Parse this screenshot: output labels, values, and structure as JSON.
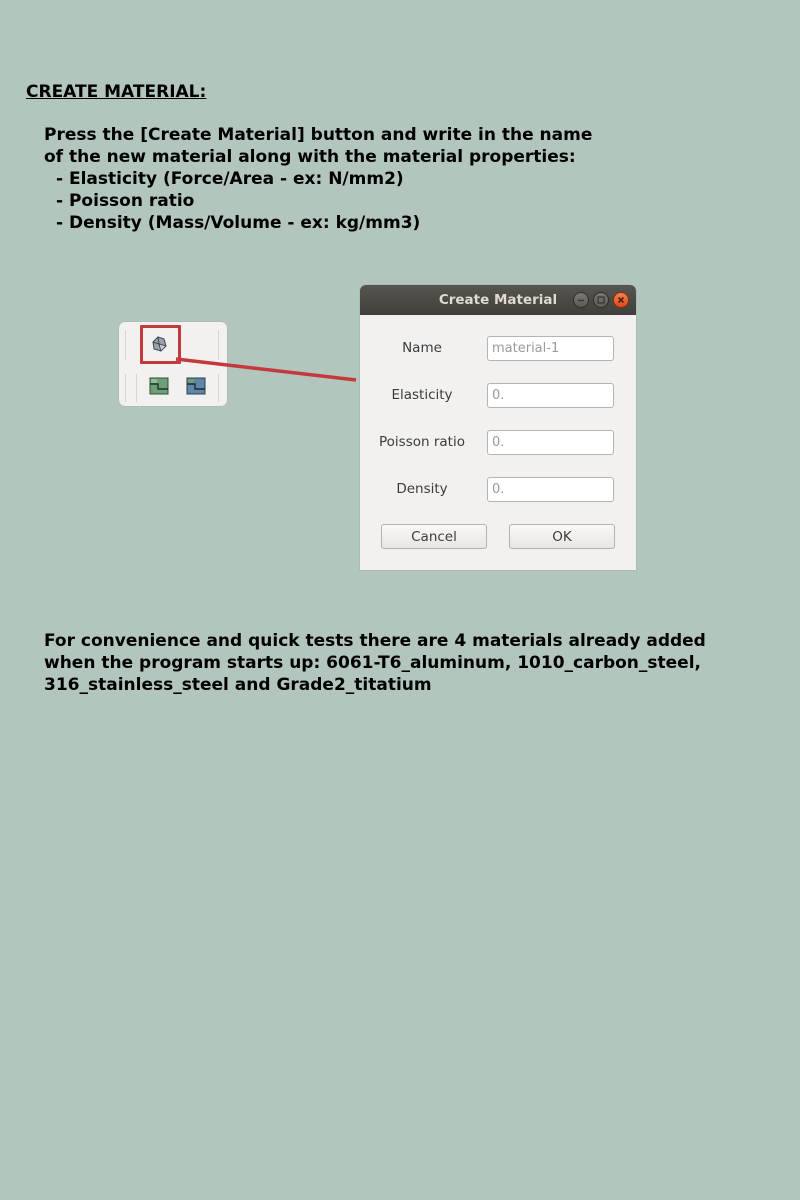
{
  "instructions": {
    "heading": "CREATE MATERIAL:",
    "intro_lines": [
      "Press the [Create Material] button and write in the name",
      "of the new material along with the material properties:",
      "- Elasticity (Force/Area - ex: N/mm2)",
      "- Poisson ratio",
      "- Density (Mass/Volume - ex: kg/mm3)"
    ],
    "footnote_lines": [
      "For convenience and quick tests there are 4 materials already added",
      "when the program starts up: 6061-T6_aluminum, 1010_carbon_steel,",
      "316_stainless_steel and Grade2_titatium"
    ]
  },
  "toolbar": {
    "icons": [
      "create-material-icon",
      "section-icon-green",
      "section-icon-blue"
    ],
    "highlight_color": "#c4393c"
  },
  "dialog": {
    "title": "Create Material",
    "window_buttons": [
      "minimize",
      "maximize",
      "close"
    ],
    "fields": [
      {
        "label": "Name",
        "placeholder": "material-1"
      },
      {
        "label": "Elasticity",
        "placeholder": "0."
      },
      {
        "label": "Poisson ratio",
        "placeholder": "0."
      },
      {
        "label": "Density",
        "placeholder": "0."
      }
    ],
    "cancel_label": "Cancel",
    "ok_label": "OK"
  },
  "colors": {
    "background": "#b2c6bd",
    "titlebar": "#4a4843",
    "close_button": "#e5562a",
    "dialog_body": "#f2f1f0"
  }
}
